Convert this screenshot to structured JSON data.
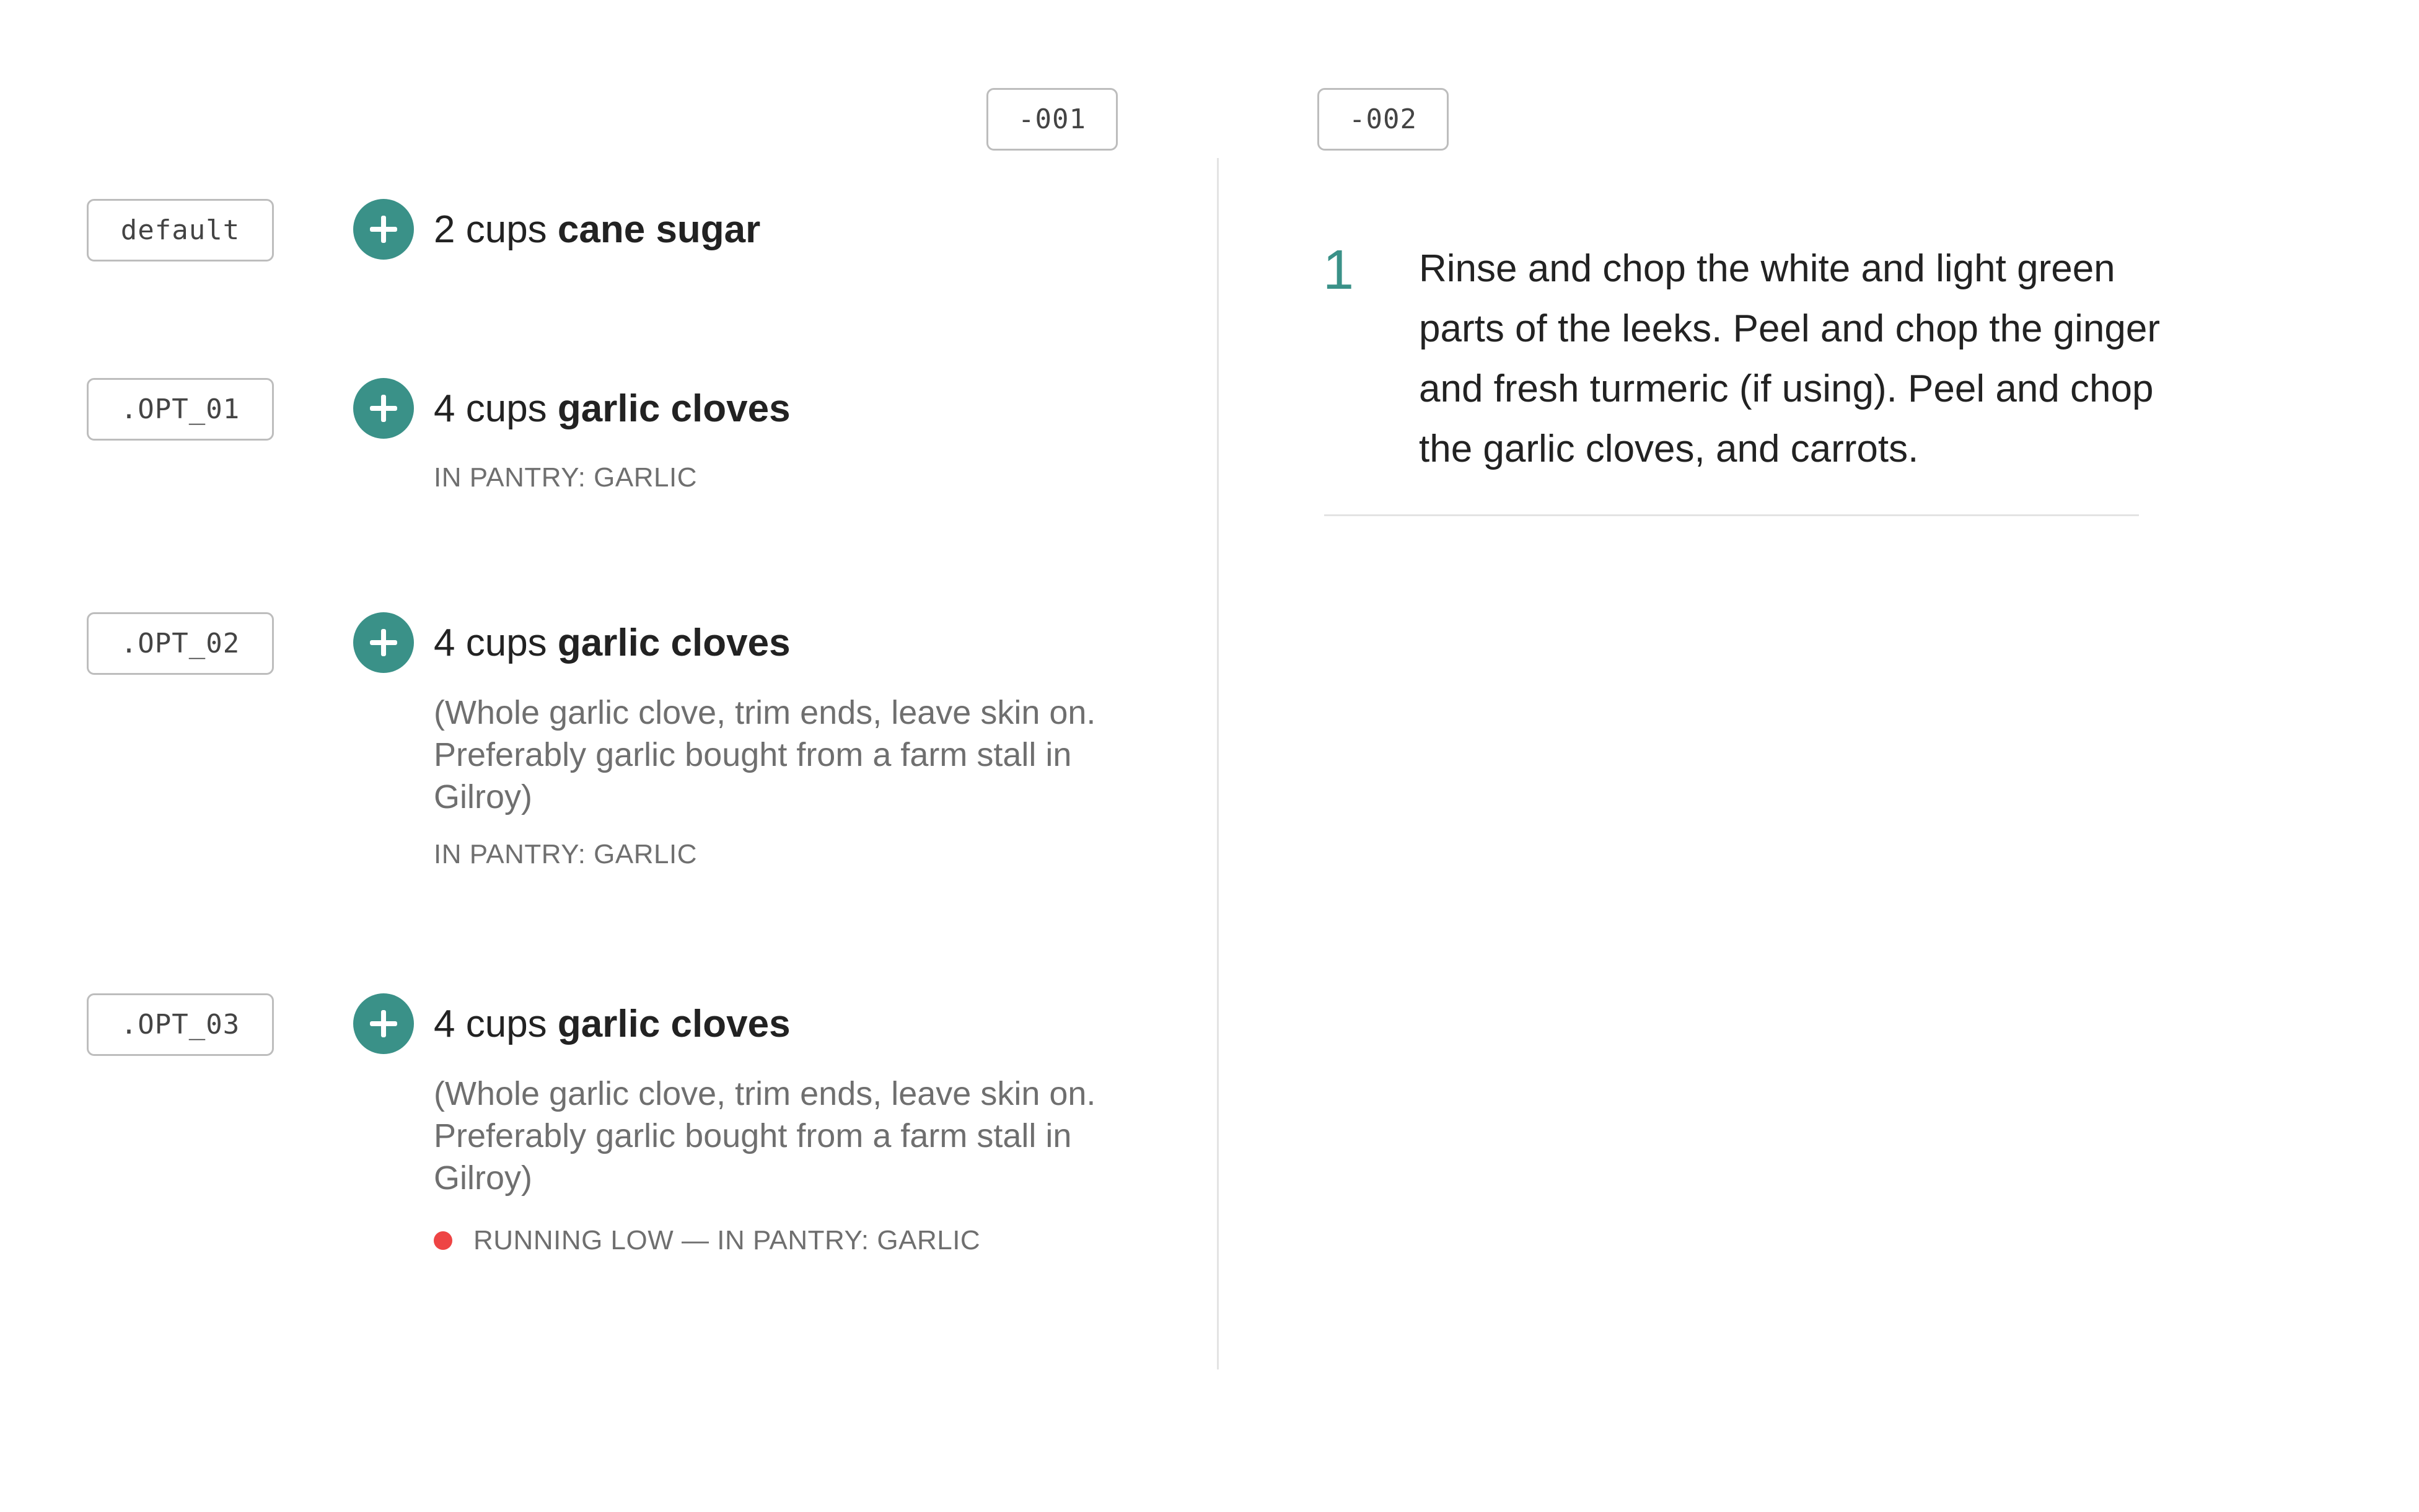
{
  "headers": {
    "col1_tag": "-001",
    "col2_tag": "-002"
  },
  "variants": [
    {
      "tag": "default",
      "quantity": "2 cups",
      "ingredient": "cane sugar"
    },
    {
      "tag": ".OPT_01",
      "quantity": "4 cups",
      "ingredient": "garlic cloves",
      "pantry": "IN PANTRY: GARLIC"
    },
    {
      "tag": ".OPT_02",
      "quantity": "4 cups",
      "ingredient": "garlic cloves",
      "note": "(Whole garlic clove, trim ends, leave skin on. Preferably garlic bought from a farm stall in Gilroy)",
      "pantry": "IN PANTRY: GARLIC"
    },
    {
      "tag": ".OPT_03",
      "quantity": "4 cups",
      "ingredient": "garlic cloves",
      "note": "(Whole garlic clove, trim ends, leave skin on. Preferably garlic bought from a farm stall in Gilroy)",
      "pantry": "RUNNING LOW — IN PANTRY: GARLIC",
      "status_color": "#ee4444"
    }
  ],
  "step": {
    "number": "1",
    "text": "Rinse and chop the white and light green parts of the leeks. Peel and chop the ginger and fresh turmeric (if using). Peel and chop the garlic cloves, and carrots."
  },
  "colors": {
    "accent": "#3a9188",
    "warning": "#ee4444",
    "muted_text": "#6f6f6f",
    "tag_border": "#bdbdbd"
  },
  "icons": {
    "add": "plus-circle-icon",
    "status": "status-dot-icon"
  }
}
